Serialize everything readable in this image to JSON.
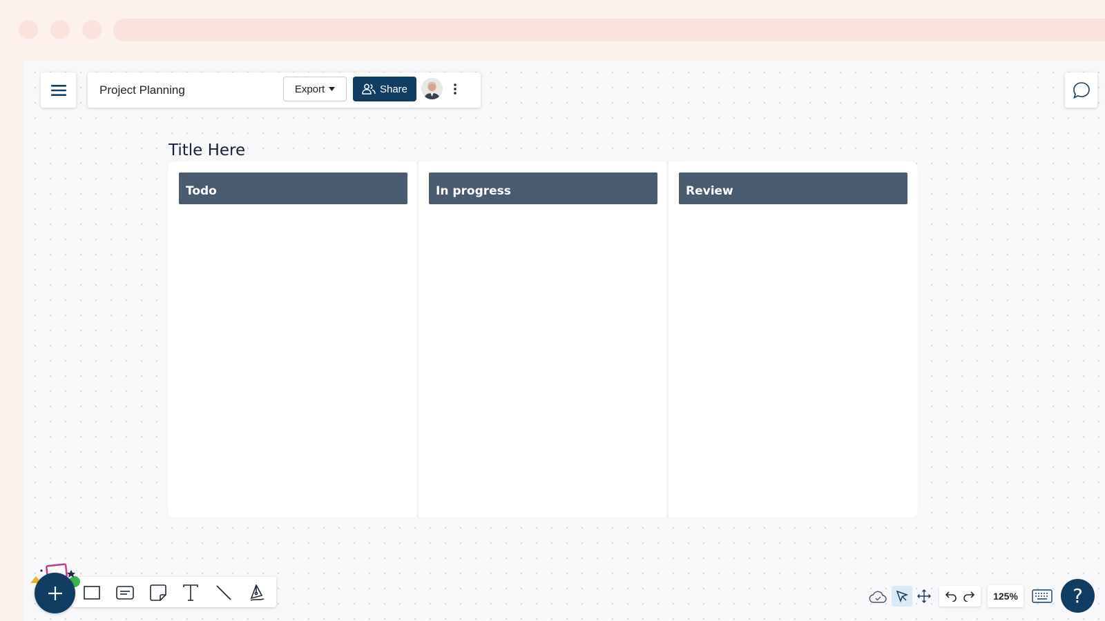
{
  "header": {
    "doc_title": "Project Planning",
    "export_label": "Export",
    "share_label": "Share"
  },
  "board": {
    "title": "Title Here",
    "columns": [
      {
        "label": "Todo"
      },
      {
        "label": "In progress"
      },
      {
        "label": "Review"
      }
    ]
  },
  "toolbar": {
    "tools": [
      "rectangle-icon",
      "card-icon",
      "sticky-note-icon",
      "text-icon",
      "line-icon",
      "pen-icon"
    ]
  },
  "bottom_right": {
    "zoom": "125%",
    "help": "?"
  },
  "colors": {
    "primary": "#123d62",
    "column_header": "#4a5a6f",
    "background": "#fdf1ee",
    "canvas": "#f8f8fa"
  }
}
